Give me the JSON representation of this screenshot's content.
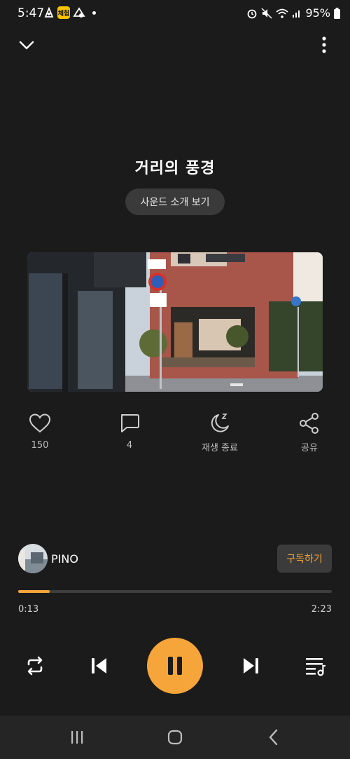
{
  "status_bar": {
    "time": "5:47",
    "battery": "95%",
    "badge_text": "체험"
  },
  "header": {
    "title": "거리의 풍경",
    "sound_intro_label": "사운드 소개 보기"
  },
  "actions": [
    {
      "icon": "heart-icon",
      "label": "150"
    },
    {
      "icon": "comment-icon",
      "label": "4"
    },
    {
      "icon": "moon-sleep-icon",
      "label": "재생 종료"
    },
    {
      "icon": "share-icon",
      "label": "공유"
    }
  ],
  "channel": {
    "name": "PINO",
    "subscribe_label": "구독하기"
  },
  "progress": {
    "current": "0:13",
    "total": "2:23",
    "fraction": 0.1
  },
  "colors": {
    "accent": "#f5a53a",
    "background": "#1b1b1b"
  }
}
